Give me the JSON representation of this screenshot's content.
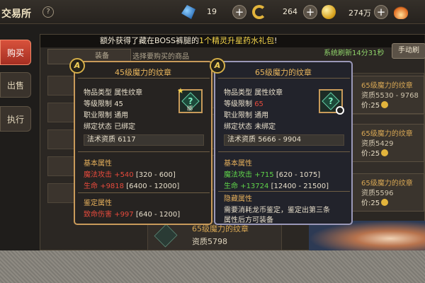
{
  "header": {
    "title": "交易所",
    "help_icon": "?",
    "currencies": [
      {
        "icon": "wing-icon",
        "amount": "19"
      },
      {
        "icon": "swirl-icon",
        "amount": "264"
      },
      {
        "icon": "coin-icon",
        "amount": "274万"
      },
      {
        "icon": "flame-icon",
        "amount": ""
      }
    ],
    "plus": "+"
  },
  "tabs": [
    "购买",
    "出售",
    "执行"
  ],
  "banner": {
    "prefix": "额外获得了藏在BOSS裤腿的",
    "highlight": "1个精灵升星药水礼包",
    "suffix": "!"
  },
  "filter": {
    "value": "装备",
    "hint": "选择要购买的商品"
  },
  "refresh": {
    "text": "系统刷新14分31秒",
    "button": "手动刷"
  },
  "right_items": [
    {
      "name": "65级魔力的纹章",
      "aptitude": "资质5530 - 9768",
      "price": "价:25"
    },
    {
      "name": "65级魔力的纹章",
      "aptitude": "资质5429",
      "price": "价:25"
    },
    {
      "name": "65级魔力的纹章",
      "aptitude": "资质5596",
      "price": "价:25"
    }
  ],
  "bottom_item": {
    "name": "65级魔力的纹章",
    "aptitude": "资质5798"
  },
  "tooltip_left": {
    "badge": "A",
    "name": "45级魔力的纹章",
    "type_k": "物品类型",
    "type_v": "属性纹章",
    "level_k": "等级限制",
    "level_v": "45",
    "job_k": "职业限制",
    "job_v": "通用",
    "bind_k": "绑定状态",
    "bind_v": "已绑定",
    "aptitude_k": "法术资质",
    "aptitude_v": "6117",
    "base_title": "基本属性",
    "attr1_k": "魔法攻击",
    "attr1_v": "+540",
    "attr1_r": "[320 - 600]",
    "attr2_k": "生命",
    "attr2_v": "+9818",
    "attr2_r": "[6400 - 12000]",
    "ident_title": "鉴定属性",
    "attr3_k": "致命伤害",
    "attr3_v": "+997",
    "attr3_r": "[640 - 1200]",
    "lock_text": "绑"
  },
  "tooltip_right": {
    "badge": "A",
    "name": "65级魔力的纹章",
    "type_k": "物品类型",
    "type_v": "属性纹章",
    "level_k": "等级限制",
    "level_v": "65",
    "job_k": "职业限制",
    "job_v": "通用",
    "bind_k": "绑定状态",
    "bind_v": "未绑定",
    "aptitude_k": "法术资质",
    "aptitude_v": "5666 - 9904",
    "base_title": "基本属性",
    "attr1_k": "魔法攻击",
    "attr1_v": "+715",
    "attr1_r": "[620 - 1075]",
    "attr2_k": "生命",
    "attr2_v": "+13724",
    "attr2_r": "[12400 - 21500]",
    "hidden_title": "隐藏属性",
    "hidden_line1": "需要消耗龙币鉴定，鉴定出第三条",
    "hidden_line2": "属性后方可装备"
  },
  "colors": {
    "accent_gold": "#e8b55c",
    "tab_active": "#c4402e",
    "stat_green": "#5fd24a",
    "level_red": "#e54a3c"
  }
}
